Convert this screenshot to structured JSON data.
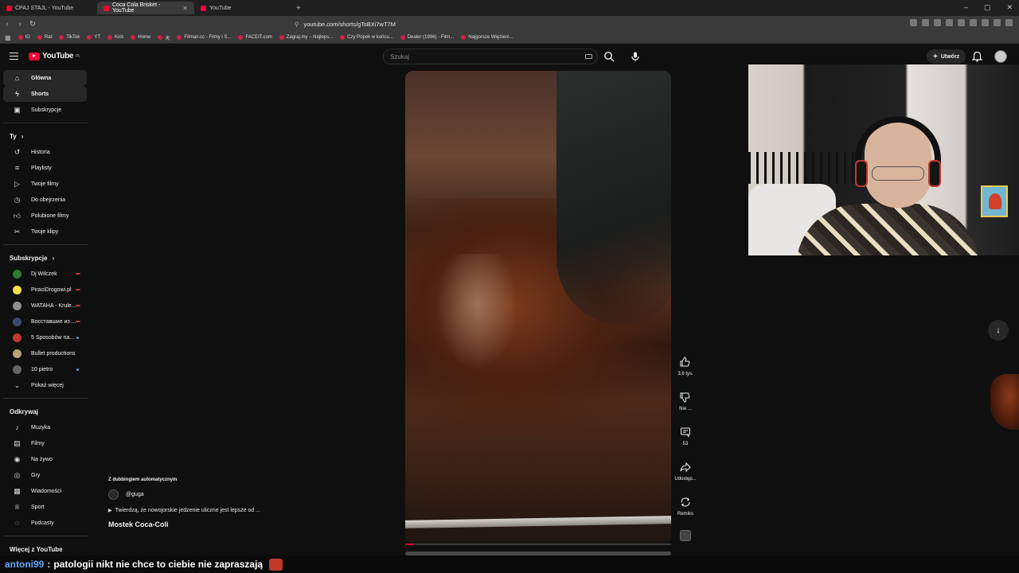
{
  "browser": {
    "tabs": [
      {
        "label": "ĆPAJ STAJL - YouTube",
        "active": false
      },
      {
        "label": "Coca Cola Brisket - YouTube",
        "active": true
      },
      {
        "label": "YouTube",
        "active": false
      }
    ],
    "new_tab": "+",
    "window_controls": [
      "–",
      "▢",
      "✕"
    ],
    "url": "youtube.com/shorts/gTsBXi7wT7M",
    "bookmarks": [
      "IG",
      "Rat",
      "TikTok",
      "YT",
      "Kick",
      "Home",
      "天",
      "Filman.cc - Filmy i S...",
      "FACEIT.com",
      "Zagraj.my – Najleps...",
      "Czy Popek w końcu...",
      "Dealer (1996) - Film...",
      "Najgorsze Więzieni..."
    ]
  },
  "header": {
    "logo": "YouTube",
    "logo_region": "PL",
    "search_placeholder": "Szukaj",
    "create_label": "Utwórz",
    "icons": [
      "menu-icon",
      "search-icon",
      "mic-icon",
      "bell-icon",
      "avatar"
    ]
  },
  "sidebar": {
    "main": [
      {
        "label": "Główna",
        "icon": "home-icon",
        "active": true
      },
      {
        "label": "Shorts",
        "icon": "shorts-icon",
        "active": true
      },
      {
        "label": "Subskrypcje",
        "icon": "subscriptions-icon",
        "active": false
      }
    ],
    "you_section": "Ty",
    "you_items": [
      {
        "label": "Historia",
        "icon": "history-icon"
      },
      {
        "label": "Playlisty",
        "icon": "playlist-icon"
      },
      {
        "label": "Twoje filmy",
        "icon": "video-icon"
      },
      {
        "label": "Do obejrzenia",
        "icon": "clock-icon"
      },
      {
        "label": "Polubione filmy",
        "icon": "like-icon"
      },
      {
        "label": "Twoje klipy",
        "icon": "scissors-icon"
      }
    ],
    "subs_section": "Subskrypcje",
    "subs": [
      {
        "label": "Dj Wilczek",
        "color": "#2e7d32",
        "marker": "live"
      },
      {
        "label": "PiraciDrogowi.pl",
        "color": "#f4e04d",
        "marker": "live"
      },
      {
        "label": "WATAHA - Krule...",
        "color": "#8e8e8e",
        "marker": "live"
      },
      {
        "label": "Восставшие из ...",
        "color": "#3a4a6a",
        "marker": "live"
      },
      {
        "label": "5 Sposobów na...",
        "color": "#c0392b",
        "marker": "new"
      },
      {
        "label": "Bullet productions",
        "color": "#b8a27a",
        "marker": "none"
      },
      {
        "label": "10 pietro",
        "color": "#666666",
        "marker": "new"
      }
    ],
    "show_more": "Pokaż więcej",
    "explore_section": "Odkrywaj",
    "explore": [
      {
        "label": "Muzyka",
        "icon": "music-icon"
      },
      {
        "label": "Filmy",
        "icon": "film-icon"
      },
      {
        "label": "Na żywo",
        "icon": "live-icon"
      },
      {
        "label": "Gry",
        "icon": "gamepad-icon"
      },
      {
        "label": "Wiadomości",
        "icon": "news-icon"
      },
      {
        "label": "Sport",
        "icon": "trophy-icon"
      },
      {
        "label": "Podcasty",
        "icon": "podcast-icon"
      }
    ],
    "more_section": "Więcej z YouTube"
  },
  "short": {
    "dubbing_note": "Z dubbingiem automatycznym",
    "channel": "@guga",
    "description": "Twierdzą, że nowojorskie jedzenie uliczne jest lepsze od ...",
    "title": "Mostek Coca-Coli",
    "progress": 0.03,
    "actions": {
      "likes": "3,6 tys.",
      "dislike": "Nie ...",
      "comments": "53",
      "share": "Udostęp...",
      "remix": "Remiks"
    }
  },
  "chat": {
    "user": "antoni99",
    "separator": ":",
    "message": "patologii nikt nie chce to ciebie nie zapraszają"
  }
}
